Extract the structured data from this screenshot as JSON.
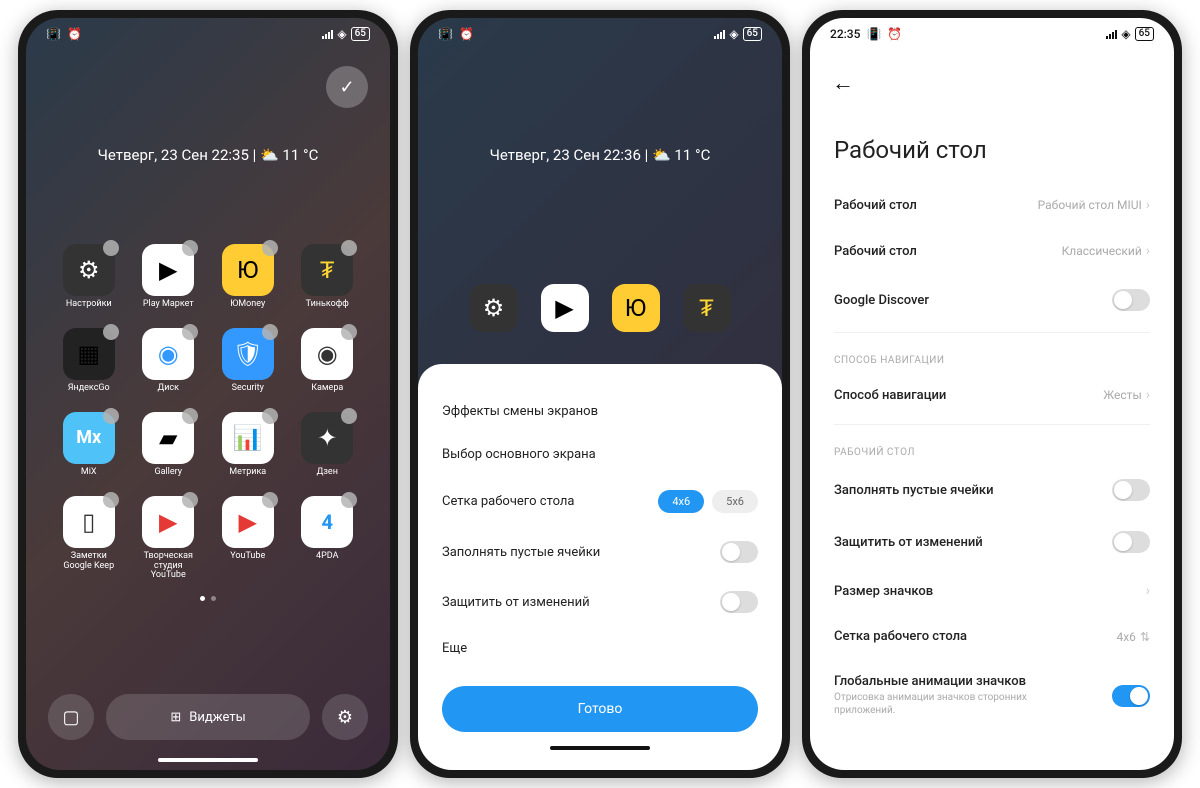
{
  "status": {
    "battery": "65",
    "time": "22:35"
  },
  "phone1": {
    "weather": "Четверг, 23 Сен  22:35 | ⛅ 11 °C",
    "apps": [
      {
        "label": "Настройки",
        "cls": "ic-settings",
        "glyph": "⚙"
      },
      {
        "label": "Play Маркет",
        "cls": "ic-play",
        "glyph": "▶"
      },
      {
        "label": "ЮMoney",
        "cls": "ic-yoomoney",
        "glyph": "Ю"
      },
      {
        "label": "Тинькофф",
        "cls": "ic-tinkoff",
        "glyph": "₮"
      },
      {
        "label": "ЯндексGo",
        "cls": "ic-yandexgo",
        "glyph": "▦"
      },
      {
        "label": "Диск",
        "cls": "ic-disk",
        "glyph": "◉"
      },
      {
        "label": "Security",
        "cls": "ic-security",
        "glyph": "🛡"
      },
      {
        "label": "Камера",
        "cls": "ic-camera",
        "glyph": "◉"
      },
      {
        "label": "MiX",
        "cls": "ic-mix",
        "glyph": "Mx"
      },
      {
        "label": "Gallery",
        "cls": "ic-gallery",
        "glyph": "▰"
      },
      {
        "label": "Метрика",
        "cls": "ic-metrika",
        "glyph": "📊"
      },
      {
        "label": "Дзен",
        "cls": "ic-dzen",
        "glyph": "✦"
      },
      {
        "label": "Заметки Google Keep",
        "cls": "ic-keep",
        "glyph": "▯"
      },
      {
        "label": "Творческая студия YouTube",
        "cls": "ic-ytstudio",
        "glyph": "▶"
      },
      {
        "label": "YouTube",
        "cls": "ic-youtube",
        "glyph": "▶"
      },
      {
        "label": "4PDA",
        "cls": "ic-4pda",
        "glyph": "4"
      }
    ],
    "widgets_label": "Виджеты"
  },
  "phone2": {
    "weather": "Четверг, 23 Сен  22:36 | ⛅ 11 °C",
    "strip": [
      {
        "cls": "ic-settings",
        "glyph": "⚙"
      },
      {
        "cls": "ic-play",
        "glyph": "▶"
      },
      {
        "cls": "ic-yoomoney",
        "glyph": "Ю"
      },
      {
        "cls": "ic-tinkoff",
        "glyph": "₮"
      }
    ],
    "rows": {
      "effects": "Эффекты смены экранов",
      "default_screen": "Выбор основного экрана",
      "grid": "Сетка рабочего стола",
      "grid_4x6": "4x6",
      "grid_5x6": "5x6",
      "fill_empty": "Заполнять пустые ячейки",
      "lock": "Защитить от изменений",
      "more": "Еще"
    },
    "done": "Готово"
  },
  "phone3": {
    "title": "Рабочий стол",
    "rows": {
      "launcher_label": "Рабочий стол",
      "launcher_value": "Рабочий стол MIUI",
      "mode_label": "Рабочий стол",
      "mode_value": "Классический",
      "discover": "Google Discover",
      "nav_header": "СПОСОБ НАВИГАЦИИ",
      "nav_label": "Способ навигации",
      "nav_value": "Жесты",
      "home_header": "РАБОЧИЙ СТОЛ",
      "fill_empty": "Заполнять пустые ячейки",
      "lock": "Защитить от изменений",
      "icon_size": "Размер значков",
      "grid_label": "Сетка рабочего стола",
      "grid_value": "4x6",
      "anim_label": "Глобальные анимации значков",
      "anim_sub": "Отрисовка анимации значков сторонних приложений."
    }
  }
}
